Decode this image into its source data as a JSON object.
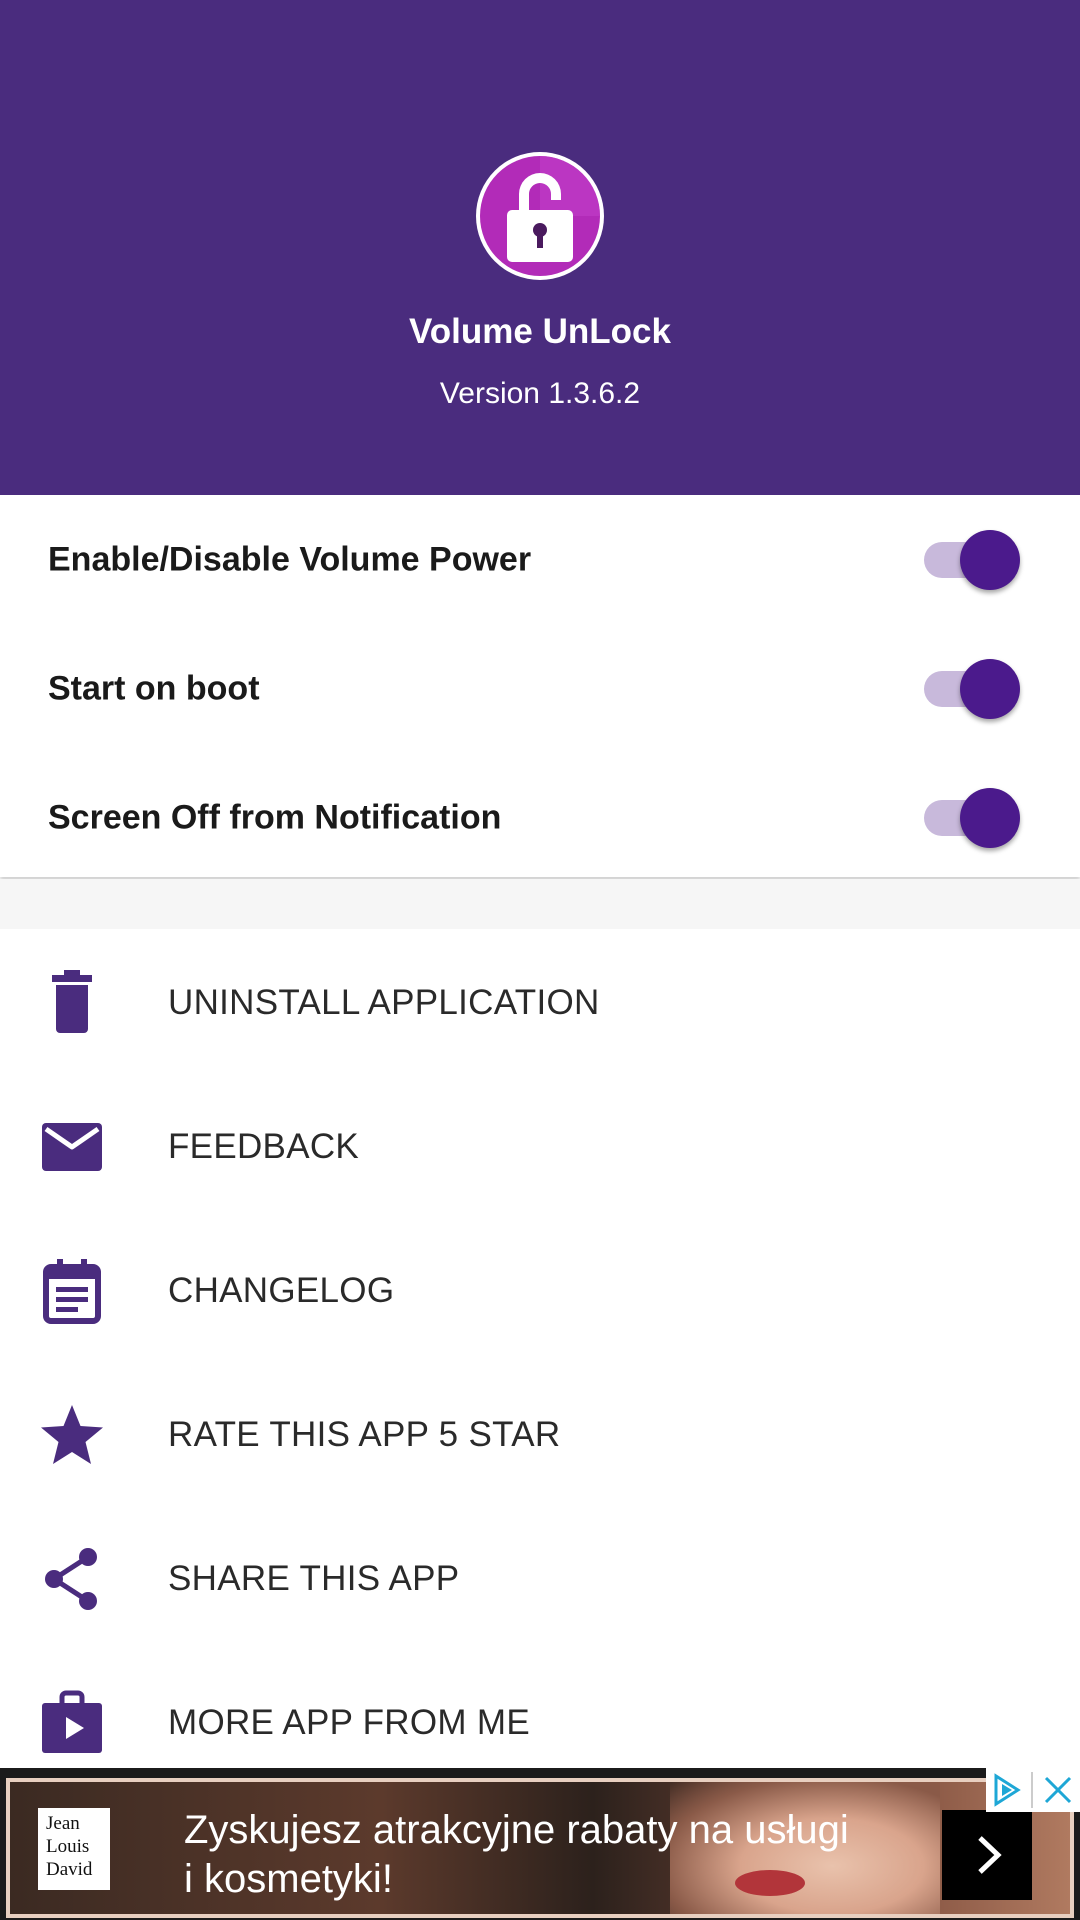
{
  "header": {
    "app_name": "Volume UnLock",
    "version": "Version 1.3.6.2"
  },
  "settings": [
    {
      "label": "Enable/Disable Volume Power",
      "enabled": true
    },
    {
      "label": "Start on boot",
      "enabled": true
    },
    {
      "label": "Screen Off from Notification",
      "enabled": true
    }
  ],
  "menu": [
    {
      "label": "UNINSTALL APPLICATION",
      "icon": "trash-icon"
    },
    {
      "label": "FEEDBACK",
      "icon": "mail-icon"
    },
    {
      "label": "CHANGELOG",
      "icon": "calendar-note-icon"
    },
    {
      "label": "RATE THIS APP 5 STAR",
      "icon": "star-icon"
    },
    {
      "label": "SHARE THIS APP",
      "icon": "share-icon"
    },
    {
      "label": "MORE APP FROM ME",
      "icon": "store-bag-icon"
    }
  ],
  "ad": {
    "brand": "Jean Louis David",
    "text_line1": "Zyskujesz atrakcyjne rabaty na usługi",
    "text_line2": "i kosmetyki!"
  },
  "colors": {
    "header_bg": "#4a2c7e",
    "switch_thumb": "#4b1a8c",
    "switch_track": "#c8b9db",
    "icon_color": "#4a2c7e"
  }
}
